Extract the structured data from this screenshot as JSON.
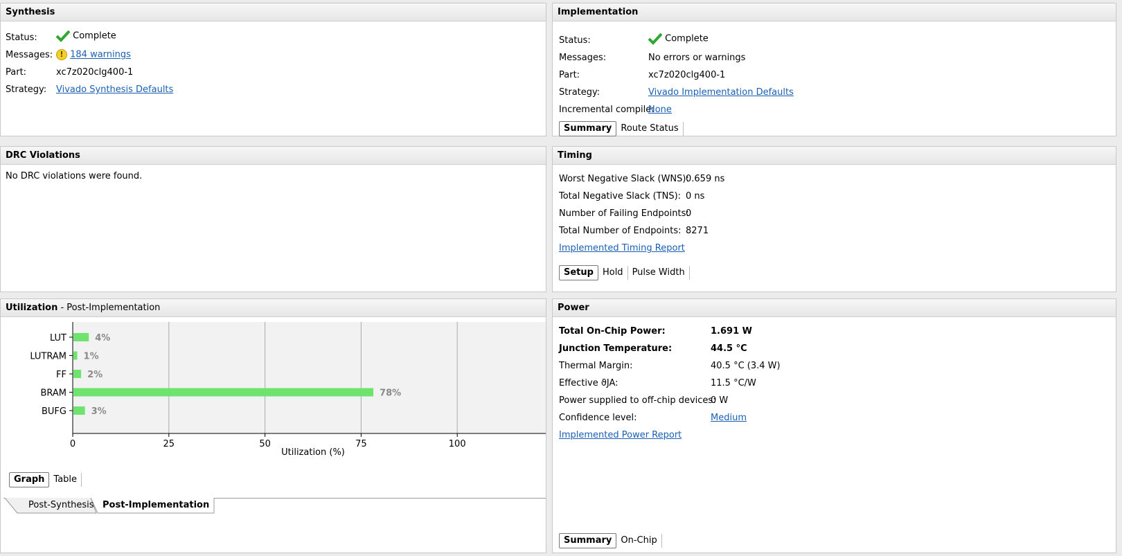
{
  "synthesis": {
    "title": "Synthesis",
    "status_label": "Status:",
    "status_value": "Complete",
    "messages_label": "Messages:",
    "messages_value": "184 warnings",
    "part_label": "Part:",
    "part_value": "xc7z020clg400-1",
    "strategy_label": "Strategy:",
    "strategy_value": "Vivado Synthesis Defaults"
  },
  "implementation": {
    "title": "Implementation",
    "status_label": "Status:",
    "status_value": "Complete",
    "messages_label": "Messages:",
    "messages_value": "No errors or warnings",
    "part_label": "Part:",
    "part_value": "xc7z020clg400-1",
    "strategy_label": "Strategy:",
    "strategy_value": "Vivado Implementation Defaults",
    "incremental_label": "Incremental compile:",
    "incremental_value": "None",
    "tabs": [
      "Summary",
      "Route Status"
    ]
  },
  "drc": {
    "title": "DRC Violations",
    "message": "No DRC violations were found."
  },
  "timing": {
    "title": "Timing",
    "rows": [
      {
        "label": "Worst Negative Slack (WNS):",
        "value": "0.659 ns"
      },
      {
        "label": "Total Negative Slack (TNS):",
        "value": "0 ns"
      },
      {
        "label": "Number of Failing Endpoints:",
        "value": "0"
      },
      {
        "label": "Total Number of Endpoints:",
        "value": "8271"
      }
    ],
    "report_link": "Implemented Timing Report",
    "tabs": [
      "Setup",
      "Hold",
      "Pulse Width"
    ]
  },
  "utilization": {
    "title": "Utilization",
    "subtitle": " - Post-Implementation",
    "view_tabs": [
      "Graph",
      "Table"
    ],
    "stage_tabs": [
      "Post-Synthesis",
      "Post-Implementation"
    ]
  },
  "chart_data": {
    "type": "bar",
    "orientation": "horizontal",
    "categories": [
      "LUT",
      "LUTRAM",
      "FF",
      "BRAM",
      "BUFG"
    ],
    "values": [
      4,
      1,
      2,
      78,
      3
    ],
    "value_labels": [
      "4%",
      "1%",
      "2%",
      "78%",
      "3%"
    ],
    "xlabel": "Utilization (%)",
    "xticks": [
      0,
      25,
      50,
      75,
      100
    ],
    "xlim": [
      0,
      125
    ],
    "grid": true,
    "bar_color": "#6ee46e"
  },
  "power": {
    "title": "Power",
    "rows": [
      {
        "label": "Total On-Chip Power:",
        "value": "1.691 W",
        "bold": true
      },
      {
        "label": "Junction Temperature:",
        "value": "44.5 °C",
        "bold": true
      },
      {
        "label": "Thermal Margin:",
        "value": "40.5 °C (3.4 W)",
        "bold": false
      },
      {
        "label": "Effective ϑJA:",
        "value": "11.5 °C/W",
        "bold": false
      },
      {
        "label": "Power supplied to off-chip devices:",
        "value": "0 W",
        "bold": false
      },
      {
        "label": "Confidence level:",
        "value": "Medium",
        "bold": false,
        "link": true
      }
    ],
    "report_link": "Implemented Power Report",
    "tabs": [
      "Summary",
      "On-Chip"
    ]
  }
}
